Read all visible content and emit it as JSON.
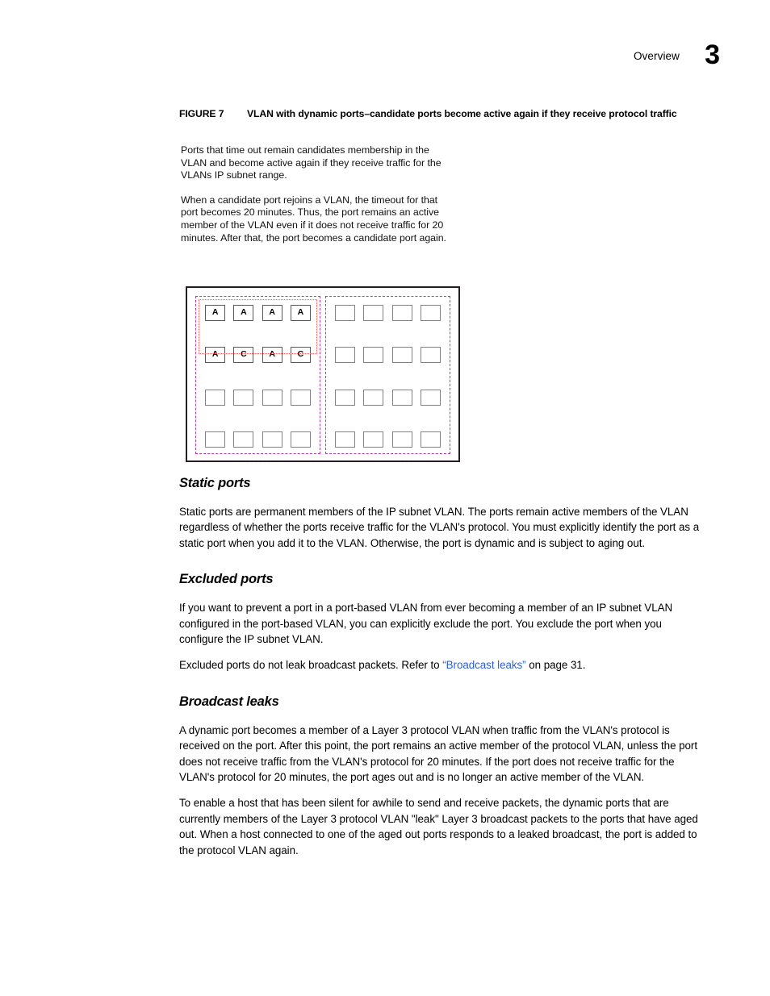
{
  "header": {
    "title": "Overview",
    "page_number": "3"
  },
  "figure": {
    "label": "FIGURE 7",
    "caption": "VLAN with dynamic ports–candidate ports become active again if they receive protocol traffic",
    "annotations": [
      "Ports that time out remain candidates membership in the VLAN and become active again if they receive traffic for the VLANs IP subnet range.",
      "When a candidate port rejoins a VLAN, the timeout for that port becomes 20 minutes. Thus, the port remains an active member of the VLAN even if it does not receive traffic for 20 minutes. After that, the port becomes a candidate port again."
    ],
    "colors": {
      "vlan_boundary": "#b23fae",
      "active_highlight": "#f0625e",
      "port_border": "#808285",
      "frame": "#231f20"
    },
    "panels": [
      {
        "name": "left-module",
        "rows": [
          [
            "A",
            "A",
            "A",
            "A"
          ],
          [
            "A",
            "C",
            "A",
            "C"
          ],
          [
            "",
            "",
            "",
            ""
          ],
          [
            "",
            "",
            "",
            ""
          ]
        ]
      },
      {
        "name": "right-module",
        "rows": [
          [
            "",
            "",
            "",
            ""
          ],
          [
            "",
            "",
            "",
            ""
          ],
          [
            "",
            "",
            "",
            ""
          ],
          [
            "",
            "",
            "",
            ""
          ]
        ]
      }
    ]
  },
  "sections": [
    {
      "heading": "Static ports",
      "paragraphs": [
        "Static ports are permanent members of the IP subnet VLAN. The ports remain active members of the VLAN regardless of whether the ports receive traffic for the VLAN's protocol. You must explicitly identify the port as a static port when you add it to the VLAN. Otherwise, the port is dynamic and is subject to aging out."
      ]
    },
    {
      "heading": "Excluded ports",
      "paragraphs": [
        "If you want to prevent a port in a port-based VLAN from ever becoming a member of an IP subnet VLAN configured in the port-based VLAN, you can explicitly exclude the port. You exclude the port when you configure the IP subnet VLAN."
      ],
      "xref_paragraph": {
        "before": "Excluded ports do not leak broadcast packets. Refer to ",
        "link": "“Broadcast leaks”",
        "after": " on page 31."
      }
    },
    {
      "heading": "Broadcast leaks",
      "paragraphs": [
        "A dynamic port becomes a member of a Layer 3 protocol VLAN when traffic from the VLAN's protocol is received on the port. After this point, the port remains an active member of the protocol VLAN, unless the port does not receive traffic from the VLAN's protocol for 20 minutes. If the port does not receive traffic for the VLAN's protocol for 20 minutes, the port ages out and is no longer an active member of the VLAN.",
        "To enable a host that has been silent for awhile to send and receive packets, the dynamic ports that are currently members of the Layer 3 protocol VLAN \"leak\" Layer 3 broadcast packets to the ports that have aged out. When a host connected to one of the aged out ports responds to a leaked broadcast, the port is added to the protocol VLAN again."
      ]
    }
  ]
}
